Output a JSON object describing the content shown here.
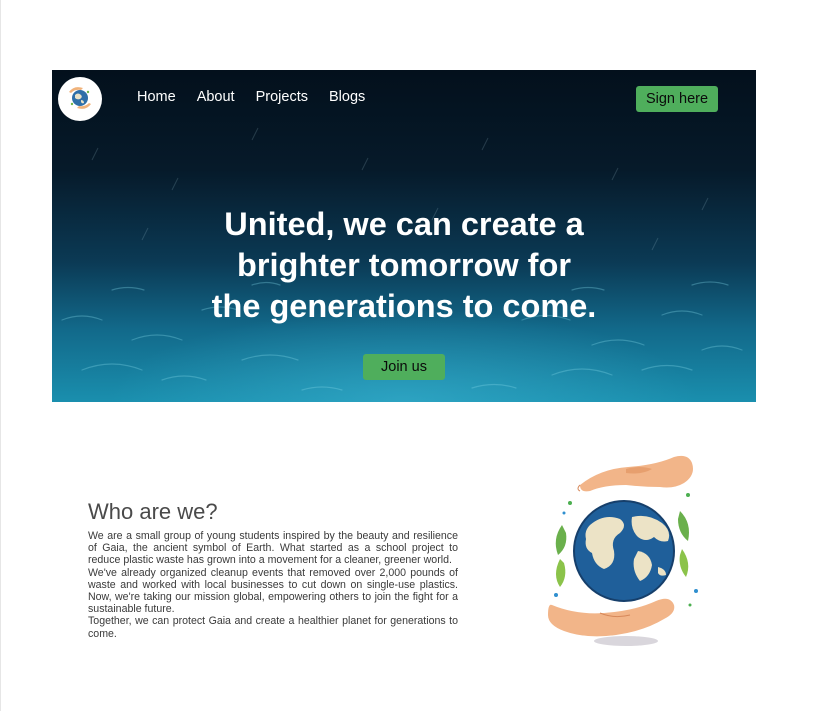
{
  "nav": {
    "items": [
      {
        "label": "Home"
      },
      {
        "label": "About"
      },
      {
        "label": "Projects"
      },
      {
        "label": "Blogs"
      }
    ],
    "sign_label": "Sign here"
  },
  "hero": {
    "title": "United, we can create a\nbrighter tomorrow for\nthe generations to come.",
    "join_label": "Join us"
  },
  "about": {
    "title": "Who are we?",
    "paragraphs": [
      "We are a small group of young students inspired by the beauty and resilience of Gaia, the ancient symbol of Earth. What started as a school project to reduce plastic waste has grown into a movement for a cleaner, greener world.",
      "We've already organized cleanup events that removed over 2,000 pounds of waste and worked with local businesses to cut down on single-use plastics. Now, we're taking our mission global, empowering others to join the fight for a sustainable future.",
      "Together, we can protect Gaia and create a healthier planet for generations to come."
    ]
  },
  "colors": {
    "accent_green": "#4fae5c",
    "hero_deep": "#03101c",
    "hero_water": "#1a8fae"
  },
  "icons": {
    "logo": "earth-hands-logo-icon",
    "illustration": "earth-in-hands-icon"
  }
}
